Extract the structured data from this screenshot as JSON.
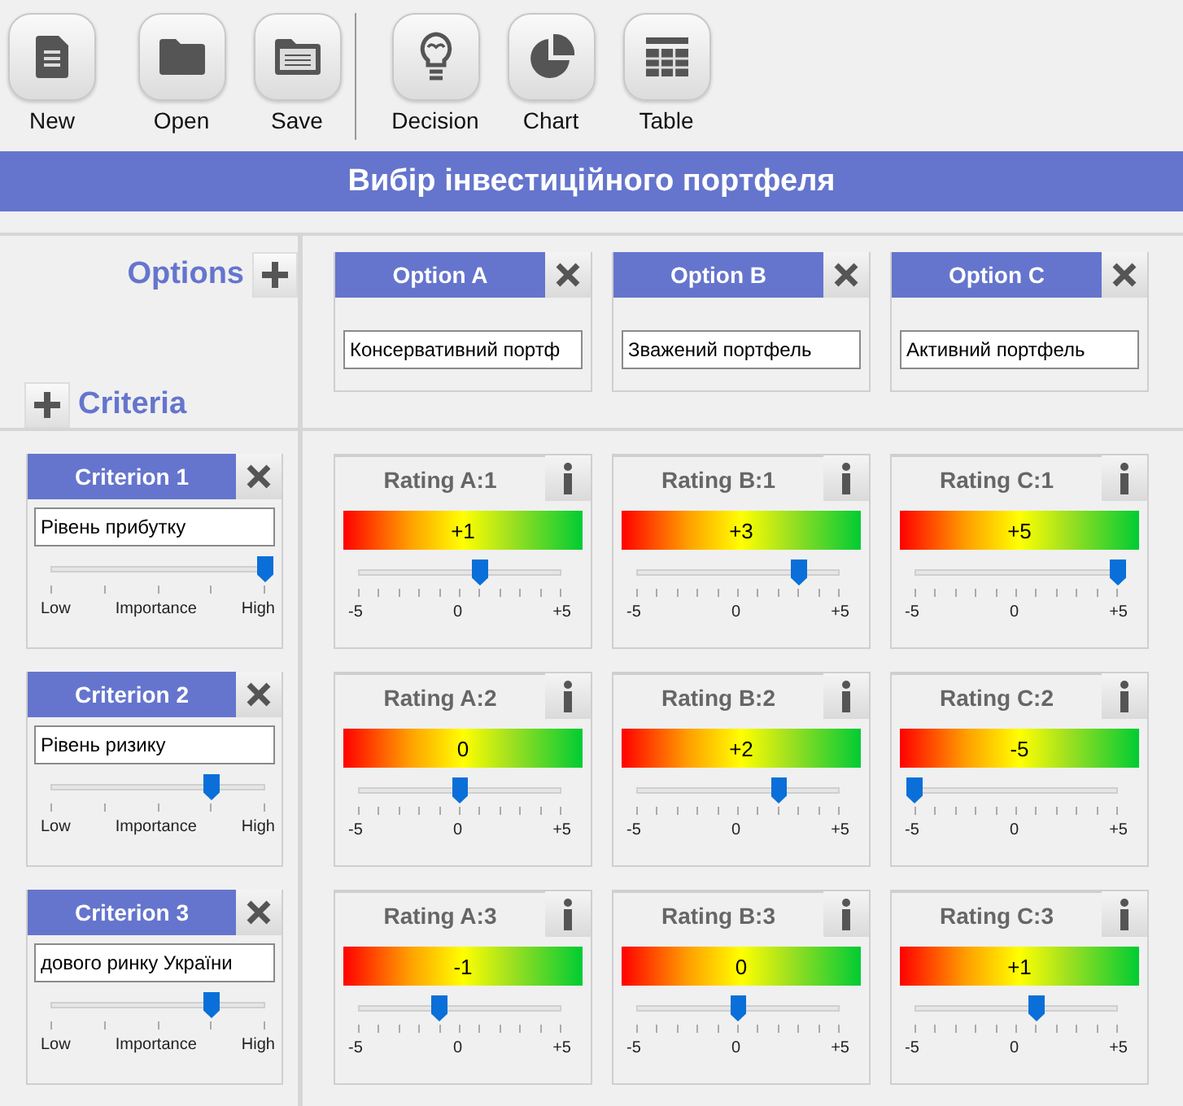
{
  "toolbar": [
    {
      "label": "New",
      "kind": "new"
    },
    {
      "label": "Open",
      "kind": "open"
    },
    {
      "label": "Save",
      "kind": "save"
    },
    {
      "label": "Decision",
      "kind": "decision"
    },
    {
      "label": "Chart",
      "kind": "chart"
    },
    {
      "label": "Table",
      "kind": "table"
    }
  ],
  "title": "Вибір інвестиційного портфеля",
  "options_heading": "Options",
  "criteria_heading": "Criteria",
  "options": [
    {
      "label": "Option A",
      "name": "Консервативний портф"
    },
    {
      "label": "Option B",
      "name": "Зважений портфель"
    },
    {
      "label": "Option C",
      "name": "Активний портфель"
    }
  ],
  "criteria": [
    {
      "label": "Criterion 1",
      "name": "Рівень прибутку",
      "level": 1,
      "scale": [
        "Low",
        "Importance",
        "High"
      ],
      "ratings": [
        {
          "label": "Rating A:1",
          "value": "+1",
          "level": 0.6,
          "scale": [
            "-5",
            "0",
            "+5"
          ]
        },
        {
          "label": "Rating B:1",
          "value": "+3",
          "level": 0.8,
          "scale": [
            "-5",
            "0",
            "+5"
          ]
        },
        {
          "label": "Rating C:1",
          "value": "+5",
          "level": 1,
          "scale": [
            "-5",
            "0",
            "+5"
          ]
        }
      ]
    },
    {
      "label": "Criterion 2",
      "name": "Рівень ризику",
      "level": 0.75,
      "scale": [
        "Low",
        "Importance",
        "High"
      ],
      "ratings": [
        {
          "label": "Rating A:2",
          "value": "0",
          "level": 0.5,
          "scale": [
            "-5",
            "0",
            "+5"
          ]
        },
        {
          "label": "Rating B:2",
          "value": "+2",
          "level": 0.7,
          "scale": [
            "-5",
            "0",
            "+5"
          ]
        },
        {
          "label": "Rating C:2",
          "value": "-5",
          "level": 0,
          "scale": [
            "-5",
            "0",
            "+5"
          ]
        }
      ]
    },
    {
      "label": "Criterion 3",
      "name": "дового ринку України",
      "level": 0.75,
      "scale": [
        "Low",
        "Importance",
        "High"
      ],
      "ratings": [
        {
          "label": "Rating A:3",
          "value": "-1",
          "level": 0.4,
          "scale": [
            "-5",
            "0",
            "+5"
          ]
        },
        {
          "label": "Rating B:3",
          "value": "0",
          "level": 0.5,
          "scale": [
            "-5",
            "0",
            "+5"
          ]
        },
        {
          "label": "Rating C:3",
          "value": "+1",
          "level": 0.6,
          "scale": [
            "-5",
            "0",
            "+5"
          ]
        }
      ]
    }
  ]
}
